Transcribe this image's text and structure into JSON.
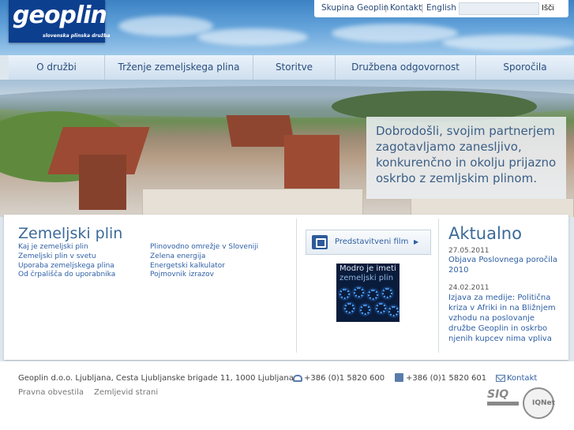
{
  "brand": {
    "logo_text": "geoplin",
    "tagline": "slovenska plinska družba"
  },
  "toplinks": {
    "group": "Skupina Geoplin",
    "contact": "Kontakt",
    "english": "English",
    "search_value": "",
    "search_button": "Išči"
  },
  "nav": [
    {
      "label": "O družbi"
    },
    {
      "label": "Trženje zemeljskega plina"
    },
    {
      "label": "Storitve"
    },
    {
      "label": "Družbena odgovornost"
    },
    {
      "label": "Sporočila"
    }
  ],
  "hero": {
    "welcome": "Dobrodošli, svojim partnerjem zagotavljamo zanesljivo, konkurenčno in okolju prijazno oskrbo z zemljskim plinom."
  },
  "gas": {
    "title": "Zemeljski plin",
    "links_left": [
      "Kaj je zemeljski plin",
      "Zemeljski plin v svetu",
      "Uporaba zemeljskega plina",
      "Od črpališča do uporabnika"
    ],
    "links_right": [
      "Plinovodno omrežje v Sloveniji",
      "Zelena energija",
      "Energetski kalkulator",
      "Pojmovnik izrazov"
    ]
  },
  "media": {
    "film_label": "Predstavitveni film",
    "banner_line1": "Modro je imeti",
    "banner_line2": "zemeljski plin"
  },
  "news": {
    "title": "Aktualno",
    "items": [
      {
        "date": "27.05.2011",
        "text": "Objava Poslovnega poročila 2010"
      },
      {
        "date": "24.02.2011",
        "text": "Izjava za medije: Politična kriza v Afriki in na Bližnjem vzhodu na poslovanje družbe Geoplin in oskrbo njenih kupcev nima vpliva"
      }
    ]
  },
  "footer": {
    "address": "Geoplin d.o.o. Ljubljana, Cesta Ljubljanske brigade 11, 1000 Ljubljana",
    "phone": "+386 (0)1 5820 600",
    "fax": "+386 (0)1 5820 601",
    "contact": "Kontakt",
    "legal": "Pravna obvestila",
    "sitemap": "Zemljevid strani",
    "cert_sq": "SIQ",
    "cert_iqnet": "IQNet"
  },
  "colors": {
    "brand_blue": "#0d3f8f",
    "link_blue": "#2e5fa5",
    "title_blue": "#3b6a99"
  }
}
